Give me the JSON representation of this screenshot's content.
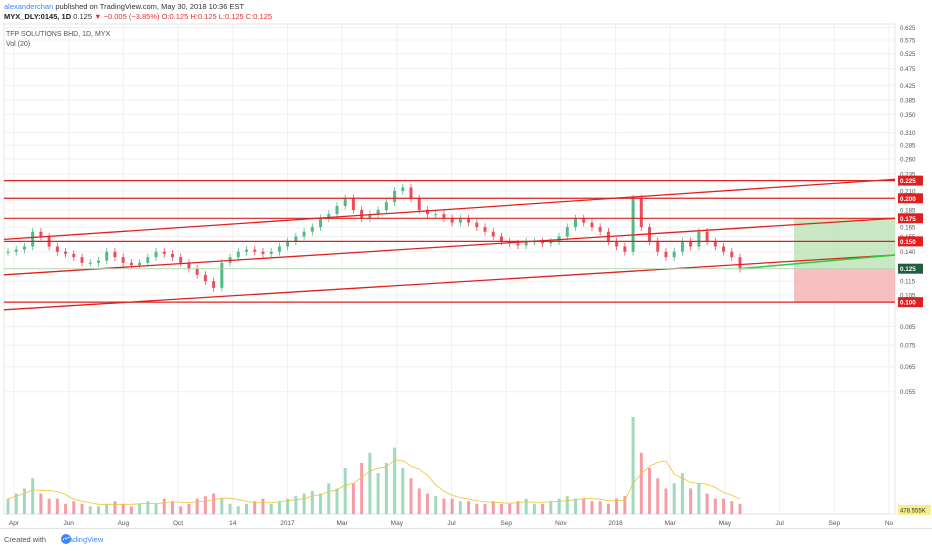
{
  "header": {
    "author": "alexanderchan",
    "published": "published on TradingView.com, May 30, 2018 10:36 EST",
    "symbol": "MYX_DLY:0145, 1D",
    "last": "0.125",
    "change": "▼ −0.005 (−3.85%)",
    "ohlc": "O:0.125 H:0.125 L:0.125 C:0.125"
  },
  "legend": {
    "title": "TFP SOLUTIONS BHD, 1D, MYX",
    "volume": "Vol (20)"
  },
  "footer": {
    "created": "Created with",
    "brand": "TradingView"
  },
  "colors": {
    "up": "#53b987",
    "down": "#eb4d5c",
    "line": "#e02020",
    "target": "#b8e0b0",
    "stop": "#f4a9a9"
  },
  "chart_data": {
    "type": "candlestick",
    "title": "TFP SOLUTIONS BHD, 1D, MYX",
    "x_ticks": [
      "Apr",
      "Jun",
      "Aug",
      "Oct",
      "14",
      "2017",
      "Mar",
      "May",
      "Jul",
      "Sep",
      "Nov",
      "2018",
      "Mar",
      "May",
      "Jul",
      "Sep",
      "No"
    ],
    "y_ticks": [
      0.625,
      0.575,
      0.525,
      0.475,
      0.425,
      0.385,
      0.35,
      0.31,
      0.285,
      0.26,
      0.235,
      0.21,
      0.185,
      0.165,
      0.155,
      0.14,
      0.125,
      0.115,
      0.105,
      0.1,
      0.085,
      0.075,
      0.065,
      0.055
    ],
    "y_scale": "log",
    "price_range": [
      0.05,
      0.64
    ],
    "horizontal_levels": [
      {
        "value": 0.225,
        "label": "0.225"
      },
      {
        "value": 0.2,
        "label": "0.200"
      },
      {
        "value": 0.175,
        "label": "0.175"
      },
      {
        "value": 0.15,
        "label": "0.150"
      },
      {
        "value": 0.1,
        "label": "0.100"
      }
    ],
    "last_price_label": "0.125",
    "volume_label": "478.555K",
    "trend_lines": [
      {
        "from": [
          "Apr 2016",
          0.152
        ],
        "to": [
          "Nov 2018",
          0.227
        ]
      },
      {
        "from": [
          "Apr 2016",
          0.12
        ],
        "to": [
          "Nov 2018",
          0.175
        ]
      },
      {
        "from": [
          "Apr 2016",
          0.095
        ],
        "to": [
          "Nov 2018",
          0.137
        ]
      }
    ],
    "position": {
      "entry": 0.125,
      "target": 0.175,
      "stop": 0.1,
      "from": "Jul 2018",
      "to": "Nov 2018"
    },
    "series": {
      "close": [
        0.14,
        0.142,
        0.145,
        0.16,
        0.155,
        0.145,
        0.14,
        0.138,
        0.135,
        0.13,
        0.13,
        0.132,
        0.14,
        0.135,
        0.13,
        0.128,
        0.13,
        0.135,
        0.14,
        0.138,
        0.135,
        0.13,
        0.125,
        0.12,
        0.115,
        0.11,
        0.13,
        0.135,
        0.14,
        0.142,
        0.14,
        0.138,
        0.14,
        0.145,
        0.15,
        0.155,
        0.16,
        0.165,
        0.175,
        0.18,
        0.19,
        0.2,
        0.185,
        0.175,
        0.18,
        0.185,
        0.195,
        0.21,
        0.215,
        0.2,
        0.185,
        0.18,
        0.18,
        0.175,
        0.17,
        0.175,
        0.17,
        0.165,
        0.16,
        0.155,
        0.15,
        0.148,
        0.146,
        0.15,
        0.15,
        0.148,
        0.15,
        0.155,
        0.165,
        0.175,
        0.17,
        0.165,
        0.16,
        0.15,
        0.145,
        0.14,
        0.2,
        0.165,
        0.15,
        0.14,
        0.135,
        0.14,
        0.15,
        0.145,
        0.16,
        0.15,
        0.145,
        0.14,
        0.135,
        0.125
      ],
      "volume": [
        0.3,
        0.4,
        0.5,
        0.7,
        0.4,
        0.3,
        0.3,
        0.2,
        0.25,
        0.2,
        0.15,
        0.15,
        0.2,
        0.25,
        0.2,
        0.15,
        0.2,
        0.25,
        0.2,
        0.3,
        0.25,
        0.15,
        0.2,
        0.3,
        0.35,
        0.4,
        0.3,
        0.2,
        0.15,
        0.2,
        0.25,
        0.3,
        0.2,
        0.25,
        0.3,
        0.35,
        0.4,
        0.45,
        0.4,
        0.6,
        0.5,
        0.9,
        0.6,
        1.0,
        1.2,
        0.8,
        1.0,
        1.3,
        0.9,
        0.7,
        0.5,
        0.4,
        0.35,
        0.3,
        0.3,
        0.25,
        0.25,
        0.2,
        0.2,
        0.25,
        0.2,
        0.2,
        0.25,
        0.3,
        0.2,
        0.2,
        0.25,
        0.3,
        0.35,
        0.3,
        0.3,
        0.25,
        0.25,
        0.2,
        0.3,
        0.35,
        1.9,
        1.2,
        0.9,
        0.7,
        0.5,
        0.6,
        0.8,
        0.5,
        0.6,
        0.4,
        0.3,
        0.3,
        0.25,
        0.2
      ]
    }
  }
}
